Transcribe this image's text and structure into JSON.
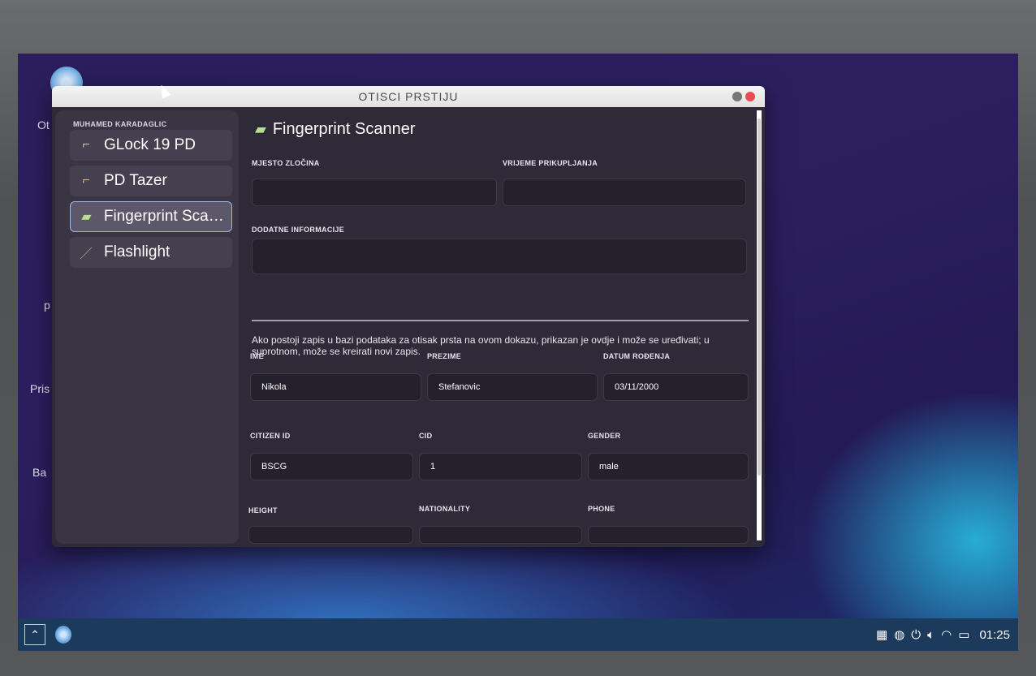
{
  "window": {
    "title": "OTISCI PRSTIJU"
  },
  "sidebar": {
    "owner": "MUHAMED KARADAGLIC",
    "items": [
      {
        "label": "GLock 19 PD",
        "icon": "pistol-icon",
        "active": false
      },
      {
        "label": "PD Tazer",
        "icon": "taser-icon",
        "active": false
      },
      {
        "label": "Fingerprint Scanner",
        "icon": "fingerprint-scanner-icon",
        "active": true
      },
      {
        "label": "Flashlight",
        "icon": "flashlight-icon",
        "active": false
      }
    ]
  },
  "main": {
    "heading": "Fingerprint Scanner",
    "fields": {
      "crime_scene": {
        "label": "MJESTO ZLOČINA",
        "value": ""
      },
      "collection_time": {
        "label": "VRIJEME PRIKUPLJANJA",
        "value": ""
      },
      "additional_info": {
        "label": "DODATNE INFORMACIJE",
        "value": ""
      }
    },
    "description": "Ako postoji zapis u bazi podataka za otisak prsta na ovom dokazu, prikazan je ovdje i može se uređivati; u suprotnom, može se kreirati novi zapis.",
    "record": {
      "first_name": {
        "label": "IME",
        "value": "Nikola"
      },
      "last_name": {
        "label": "PREZIME",
        "value": "Stefanovic"
      },
      "dob": {
        "label": "DATUM ROĐENJA",
        "value": "03/11/2000"
      },
      "citizen_id": {
        "label": "CITIZEN ID",
        "value": "BSCG"
      },
      "cid": {
        "label": "CID",
        "value": "1"
      },
      "gender": {
        "label": "GENDER",
        "value": "male"
      },
      "height": {
        "label": "HEIGHT",
        "value": ""
      },
      "nationality": {
        "label": "NATIONALITY",
        "value": ""
      },
      "phone": {
        "label": "PHONE",
        "value": ""
      }
    }
  },
  "desktop": {
    "labels": [
      "Ot",
      "p",
      "Pris",
      "Ba"
    ]
  },
  "taskbar": {
    "clock": "01:25",
    "tray_icons": [
      "qr-icon",
      "globe-icon",
      "power-icon",
      "volume-icon",
      "wifi-icon",
      "battery-icon"
    ]
  },
  "colors": {
    "accent": "#9fb6e8",
    "close": "#ee4b50",
    "taskbar": "#1b3a5c"
  }
}
